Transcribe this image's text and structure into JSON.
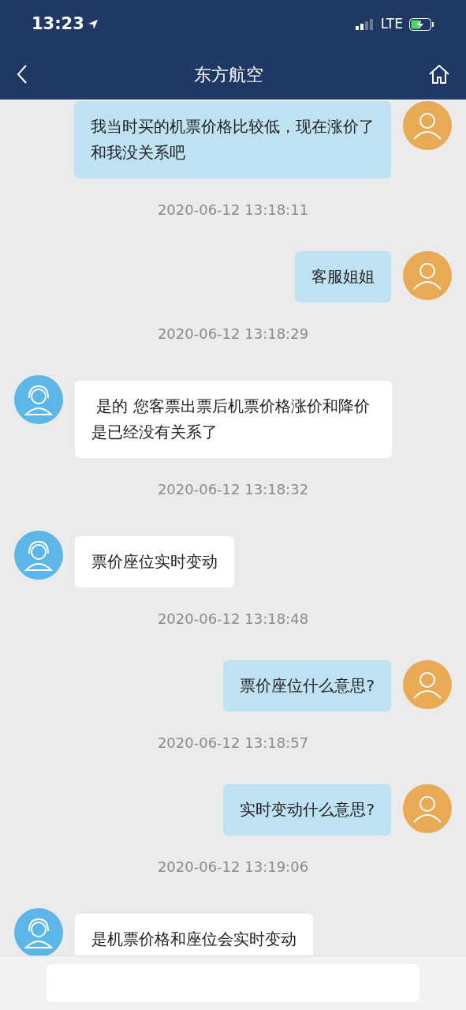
{
  "status_bar": {
    "time": "13:23",
    "network": "LTE"
  },
  "nav": {
    "title": "东方航空"
  },
  "messages": [
    {
      "kind": "sent",
      "text": "我当时买的机票价格比较低，现在涨价了和我没关系吧"
    },
    {
      "kind": "time",
      "text": "2020-06-12 13:18:11"
    },
    {
      "kind": "sent",
      "text": "客服姐姐"
    },
    {
      "kind": "time",
      "text": "2020-06-12 13:18:29"
    },
    {
      "kind": "received",
      "text": " 是的 您客票出票后机票价格涨价和降价是已经没有关系了"
    },
    {
      "kind": "time",
      "text": "2020-06-12 13:18:32"
    },
    {
      "kind": "received",
      "text": "票价座位实时变动"
    },
    {
      "kind": "time",
      "text": "2020-06-12 13:18:48"
    },
    {
      "kind": "sent",
      "text": "票价座位什么意思?"
    },
    {
      "kind": "time",
      "text": "2020-06-12 13:18:57"
    },
    {
      "kind": "sent",
      "text": "实时变动什么意思?"
    },
    {
      "kind": "time",
      "text": "2020-06-12 13:19:06"
    },
    {
      "kind": "received",
      "text": "是机票价格和座位会实时变动"
    }
  ]
}
